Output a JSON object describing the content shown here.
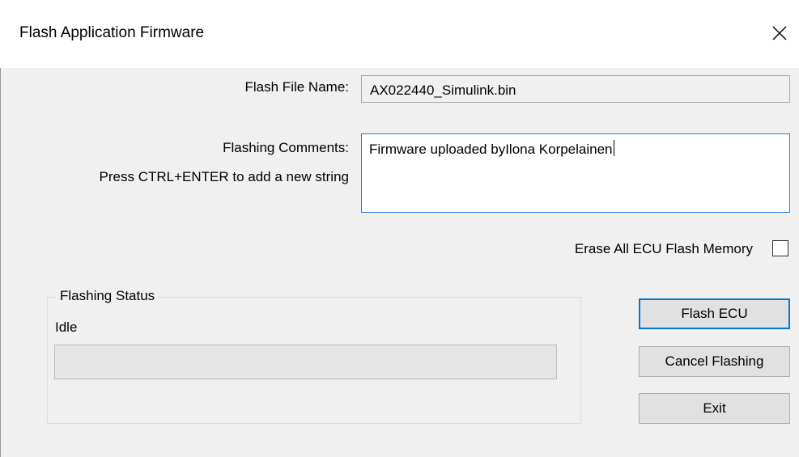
{
  "window": {
    "title": "Flash Application Firmware",
    "close_icon": "close-icon"
  },
  "form": {
    "file_label": "Flash File Name:",
    "file_value": "AX022440_Simulink.bin",
    "comments_label": "Flashing Comments:",
    "comments_hint": "Press CTRL+ENTER to add a new string",
    "comments_value": "Firmware uploaded byIlona Korpelainen",
    "erase_label": "Erase All ECU Flash Memory",
    "erase_checked": false
  },
  "status": {
    "group_title": "Flashing Status",
    "text": "Idle",
    "progress": 0
  },
  "buttons": {
    "flash": "Flash ECU",
    "cancel": "Cancel Flashing",
    "exit": "Exit"
  },
  "colors": {
    "focus_accent": "#0078d7",
    "progress_fill": "#06b025"
  }
}
